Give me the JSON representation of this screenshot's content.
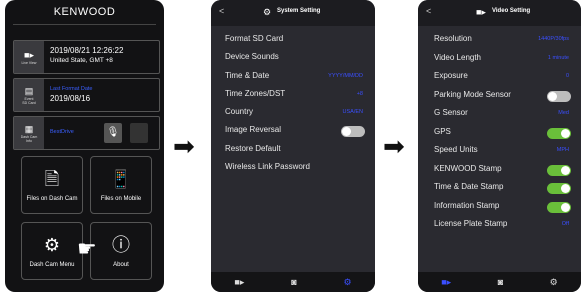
{
  "phone1": {
    "brand": "KENWOOD",
    "live_view": {
      "caption": "Live View",
      "datetime": "2019/08/21  12:26:22",
      "zone": "United State, GMT +8"
    },
    "event": {
      "caption": "Event\nSD Card",
      "label": "Last Format Date",
      "date": "2019/08/16"
    },
    "dashcam": {
      "caption": "Dash Cam\nInfo",
      "label": "BestDrive"
    },
    "tiles": [
      {
        "label": "Files on Dash Cam",
        "icon": "file-icon",
        "glyph": "🗎"
      },
      {
        "label": "Files on Mobile",
        "icon": "mobile-icon",
        "glyph": "📱"
      },
      {
        "label": "Dash Cam Menu",
        "icon": "gear-icon",
        "glyph": "⚙"
      },
      {
        "label": "About",
        "icon": "info-icon",
        "glyph": "ⓘ"
      }
    ]
  },
  "arrows": [
    "➡",
    "➡"
  ],
  "phone2": {
    "back": "<",
    "title": "System Setting",
    "items": [
      {
        "label": "Format SD Card"
      },
      {
        "label": "Device Sounds"
      },
      {
        "label": "Time & Date",
        "value": "YYYY/MM/DD"
      },
      {
        "label": "Time Zones/DST",
        "value": "+8"
      },
      {
        "label": "Country",
        "value": "USA/EN"
      },
      {
        "label": "Image Reversal",
        "toggle": "off"
      },
      {
        "label": "Restore Default"
      },
      {
        "label": "Wireless Link Password"
      }
    ]
  },
  "phone3": {
    "back": "<",
    "title": "Video Setting",
    "items": [
      {
        "label": "Resolution",
        "value": "1440P/30fps"
      },
      {
        "label": "Video Length",
        "value": "1 minute"
      },
      {
        "label": "Exposure",
        "value": "0"
      },
      {
        "label": "Parking Mode Sensor",
        "toggle": "off"
      },
      {
        "label": "G Sensor",
        "value": "Med"
      },
      {
        "label": "GPS",
        "toggle": "on"
      },
      {
        "label": "Speed Units",
        "value": "MPH"
      },
      {
        "label": "KENWOOD Stamp",
        "toggle": "on"
      },
      {
        "label": "Time & Date Stamp",
        "toggle": "on"
      },
      {
        "label": "Information Stamp",
        "toggle": "on"
      },
      {
        "label": "License Plate Stamp",
        "value": "Off"
      }
    ]
  },
  "colors": {
    "accent_blue": "#3a4fff",
    "toggle_on": "#6abf3a",
    "toggle_off": "#bdbdbd"
  }
}
